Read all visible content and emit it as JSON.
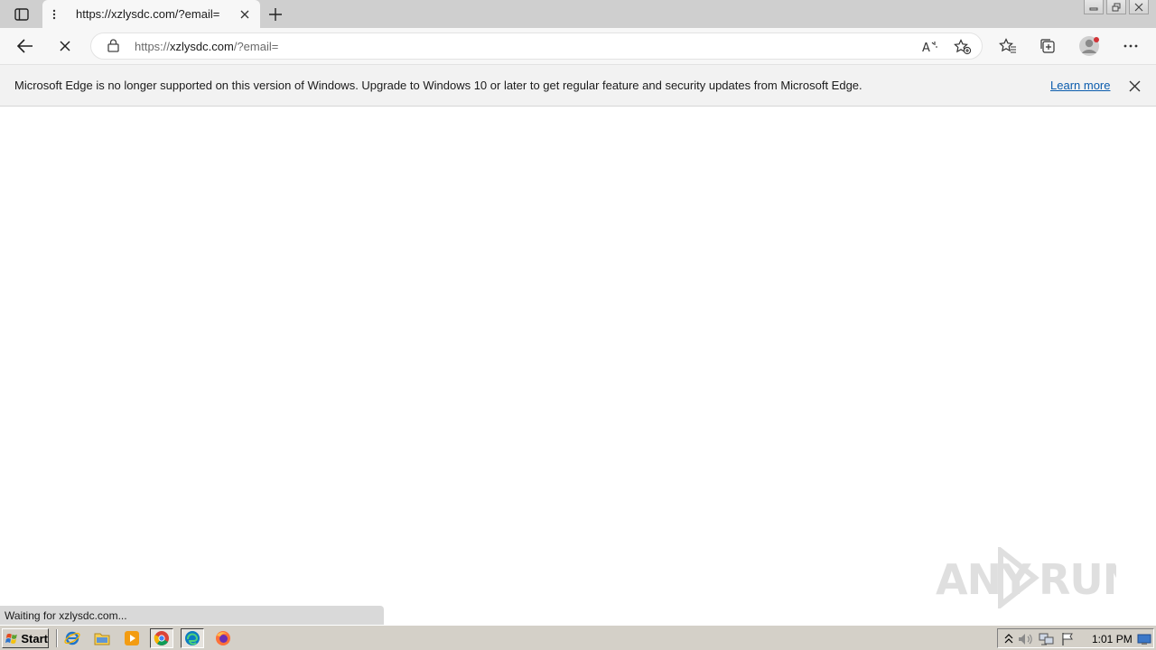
{
  "tab": {
    "title": "https://xzlysdc.com/?email="
  },
  "omnibox": {
    "url_scheme": "https://",
    "url_host": "xzlysdc.com",
    "url_path": "/?email="
  },
  "infobar": {
    "message": "Microsoft Edge is no longer supported on this version of Windows. Upgrade to Windows 10 or later to get regular feature and security updates from Microsoft Edge.",
    "link_label": "Learn more"
  },
  "status_bar": {
    "text": "Waiting for xzlysdc.com..."
  },
  "watermark": {
    "text_left": "ANY",
    "text_right": "RUN"
  },
  "taskbar": {
    "start_label": "Start",
    "clock": "1:01 PM",
    "pinned": [
      "internet-explorer-icon",
      "file-explorer-icon",
      "media-player-icon",
      "chrome-icon",
      "edge-icon",
      "firefox-icon"
    ]
  },
  "colors": {
    "link": "#0b5cad",
    "profile_badge": "#d13438"
  }
}
